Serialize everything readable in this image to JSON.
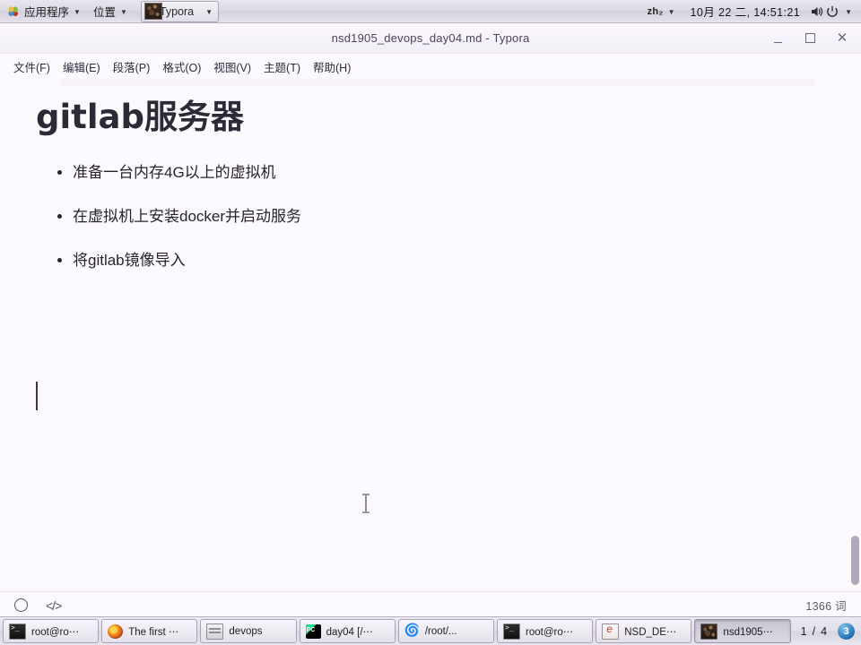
{
  "top_panel": {
    "applications_label": "应用程序",
    "places_label": "位置",
    "window_label": "Typora",
    "keyboard_layout": "zh₂",
    "clock": "10月 22 二, 14:51:21",
    "icons": {
      "apps_logo": "gnome-foot-icon",
      "volume": "volume-icon",
      "power": "power-icon"
    }
  },
  "window": {
    "title": "nsd1905_devops_day04.md - Typora",
    "controls": {
      "minimize": "minimize-button",
      "maximize": "maximize-button",
      "close": "close-button"
    }
  },
  "menu": {
    "items": [
      {
        "label": "文件(F)"
      },
      {
        "label": "编辑(E)"
      },
      {
        "label": "段落(P)"
      },
      {
        "label": "格式(O)"
      },
      {
        "label": "视图(V)"
      },
      {
        "label": "主题(T)"
      },
      {
        "label": "帮助(H)"
      }
    ]
  },
  "document": {
    "heading": "gitlab服务器",
    "heading_latin": "gitlab",
    "heading_cjk": "服务器",
    "bullets": [
      {
        "text": "准备一台内存4G以上的虚拟机"
      },
      {
        "text": "在虚拟机上安装docker并启动服务"
      },
      {
        "text": "将gitlab镜像导入"
      }
    ]
  },
  "status_bar": {
    "circle_icon": "circle-icon",
    "source_icon": "</>",
    "word_count": "1366 词"
  },
  "taskbar": {
    "items": [
      {
        "label": "root@ro⋯",
        "icon": "terminal-icon",
        "icon_class": "tico-term",
        "active": false
      },
      {
        "label": "The first ⋯",
        "icon": "firefox-icon",
        "icon_class": "tico-ff",
        "active": false
      },
      {
        "label": "devops",
        "icon": "file-manager-icon",
        "icon_class": "tico-files",
        "active": false
      },
      {
        "label": "day04 [/⋯",
        "icon": "pycharm-icon",
        "icon_class": "tico-pycharm",
        "active": false
      },
      {
        "label": "/root/...",
        "icon": "typora-blue-icon",
        "icon_class": "tico-typora",
        "active": false
      },
      {
        "label": "root@ro⋯",
        "icon": "terminal-icon",
        "icon_class": "tico-term",
        "active": false
      },
      {
        "label": "NSD_DE⋯",
        "icon": "ebook-icon",
        "icon_class": "tico-ebook",
        "active": false
      },
      {
        "label": "nsd1905⋯",
        "icon": "typora-window-thumb-icon",
        "icon_class": "tico-thumb",
        "active": true
      }
    ],
    "workspace": {
      "current": "1",
      "separator": "/",
      "total": "4"
    },
    "notification_badge": "3"
  },
  "colors": {
    "document_bg": "#fdfaff",
    "panel_bg": "#e2dfe8",
    "text": "#27242e",
    "accent_badge": "#1f6fb5"
  }
}
